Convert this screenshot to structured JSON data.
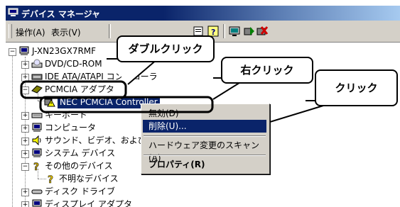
{
  "window": {
    "title": "デバイス マネージャ"
  },
  "menubar": {
    "items": [
      "操作(A)",
      "表示(V)"
    ]
  },
  "toolbar": {
    "buttons": [
      "back-icon",
      "forward-icon",
      "properties-icon",
      "help-icon",
      "scan-icon",
      "monitor-icon",
      "update-driver-icon",
      "uninstall-icon"
    ]
  },
  "tree": {
    "root": "J-XN23GX7RMF",
    "nodes": [
      {
        "label": "DVD/CD-ROM",
        "icon": "cdrom-icon",
        "expander": "+"
      },
      {
        "label": "IDE ATA/ATAPI コントローラ",
        "icon": "ide-icon",
        "expander": "+"
      },
      {
        "label": "PCMCIA アダプタ",
        "icon": "pcmcia-icon",
        "expander": "−"
      },
      {
        "label": "NEC PCMCIA Controller",
        "icon": "warning-device-icon",
        "selected": true
      },
      {
        "label": "キーボード",
        "icon": "keyboard-icon",
        "expander": "+"
      },
      {
        "label": "コンピュータ",
        "icon": "computer-icon",
        "expander": "+"
      },
      {
        "label": "サウンド、ビデオ、およびゲーム コントローラ",
        "icon": "sound-icon",
        "expander": "+"
      },
      {
        "label": "システム デバイス",
        "icon": "system-icon",
        "expander": "+"
      },
      {
        "label": "その他のデバイス",
        "icon": "question-icon",
        "expander": "−"
      },
      {
        "label": "不明なデバイス",
        "icon": "unknown-device-icon"
      },
      {
        "label": "ディスク ドライブ",
        "icon": "disk-icon",
        "expander": "+"
      },
      {
        "label": "ディスプレイ アダプタ",
        "icon": "display-icon",
        "expander": "+"
      }
    ]
  },
  "context_menu": {
    "items": [
      "無効(D)",
      "削除(U)...",
      "ハードウェア変更のスキャン(A)",
      "プロパティ(R)"
    ],
    "highlighted": "削除(U)..."
  },
  "callouts": {
    "double_click": "ダブルクリック",
    "right_click": "右クリック",
    "click": "クリック"
  },
  "colors": {
    "titlebar": "#0a246a",
    "selection": "#0a246a",
    "chrome": "#d4d0c8"
  }
}
